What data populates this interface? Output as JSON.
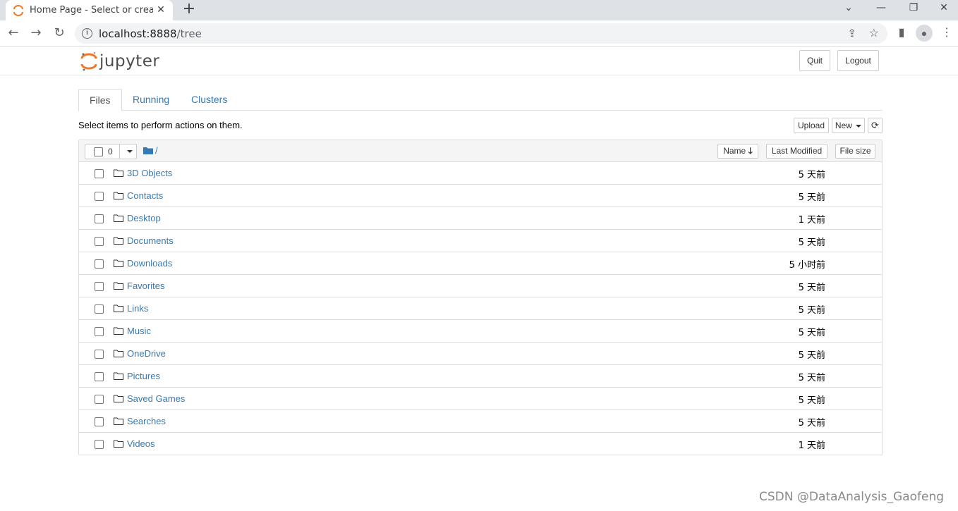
{
  "browser": {
    "tab_title": "Home Page - Select or create a notebook",
    "tab_close": "✕",
    "new_tab": "+",
    "url_host": "localhost:8888",
    "url_path": "/tree"
  },
  "header": {
    "logo_text": "jupyter",
    "quit_label": "Quit",
    "logout_label": "Logout"
  },
  "tabs": [
    {
      "label": "Files"
    },
    {
      "label": "Running"
    },
    {
      "label": "Clusters"
    }
  ],
  "toolbar": {
    "hint": "Select items to perform actions on them.",
    "upload_label": "Upload",
    "new_label": "New"
  },
  "list_header": {
    "selected_count": "0",
    "breadcrumb": "/",
    "sort_name": "Name",
    "sort_modified": "Last Modified",
    "sort_size": "File size"
  },
  "files": [
    {
      "name": "3D Objects",
      "modified": "5 天前"
    },
    {
      "name": "Contacts",
      "modified": "5 天前"
    },
    {
      "name": "Desktop",
      "modified": "1 天前"
    },
    {
      "name": "Documents",
      "modified": "5 天前"
    },
    {
      "name": "Downloads",
      "modified": "5 小时前"
    },
    {
      "name": "Favorites",
      "modified": "5 天前"
    },
    {
      "name": "Links",
      "modified": "5 天前"
    },
    {
      "name": "Music",
      "modified": "5 天前"
    },
    {
      "name": "OneDrive",
      "modified": "5 天前"
    },
    {
      "name": "Pictures",
      "modified": "5 天前"
    },
    {
      "name": "Saved Games",
      "modified": "5 天前"
    },
    {
      "name": "Searches",
      "modified": "5 天前"
    },
    {
      "name": "Videos",
      "modified": "1 天前"
    }
  ],
  "watermark": "CSDN @DataAnalysis_Gaofeng",
  "colors": {
    "link": "#337ab7",
    "jupyter_orange": "#f37726",
    "border": "#dddddd"
  }
}
